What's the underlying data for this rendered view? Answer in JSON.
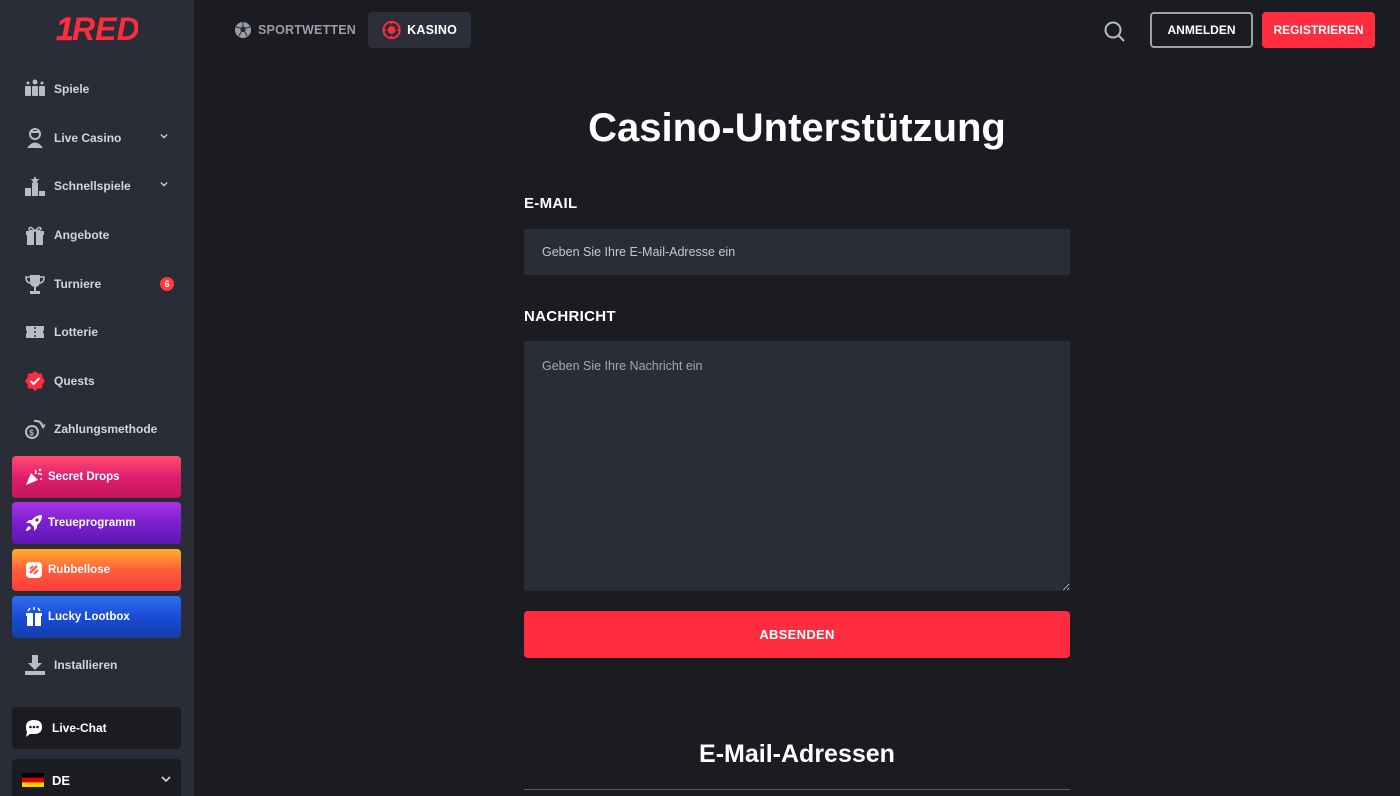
{
  "brand": {
    "logo_text": "RED",
    "accent": "#ff2c3f"
  },
  "sidebar": {
    "items": [
      {
        "label": "Spiele",
        "icon": "slot-machine-icon"
      },
      {
        "label": "Live Casino",
        "icon": "dealer-icon",
        "expandable": true
      },
      {
        "label": "Schnellspiele",
        "icon": "podium-icon",
        "expandable": true
      },
      {
        "label": "Angebote",
        "icon": "gift-icon"
      },
      {
        "label": "Turniere",
        "icon": "trophy-icon",
        "badge": "6"
      },
      {
        "label": "Lotterie",
        "icon": "ticket-icon"
      },
      {
        "label": "Quests",
        "icon": "quest-badge-icon"
      },
      {
        "label": "Zahlungsmethode",
        "icon": "payment-coins-icon"
      }
    ],
    "promos": [
      {
        "label": "Secret Drops",
        "icon": "party-popper-icon"
      },
      {
        "label": "Treueprogramm",
        "icon": "rocket-icon"
      },
      {
        "label": "Rubbellose",
        "icon": "scratch-card-icon"
      },
      {
        "label": "Lucky Lootbox",
        "icon": "lootbox-icon"
      }
    ],
    "install_label": "Installieren",
    "chat_label": "Live-Chat",
    "language": "DE"
  },
  "header": {
    "tabs": [
      {
        "label": "SPORTWETTEN",
        "icon": "soccer-ball-icon",
        "active": false
      },
      {
        "label": "KASINO",
        "icon": "casino-chip-icon",
        "active": true
      }
    ],
    "login_label": "ANMELDEN",
    "register_label": "REGISTRIEREN"
  },
  "main": {
    "title": "Casino-Unterstützung",
    "email_label": "E-MAIL",
    "email_placeholder": "Geben Sie Ihre E-Mail-Adresse ein",
    "message_label": "NACHRICHT",
    "message_placeholder": "Geben Sie Ihre Nachricht ein",
    "submit_label": "ABSENDEN",
    "section_title": "E-Mail-Adressen"
  }
}
